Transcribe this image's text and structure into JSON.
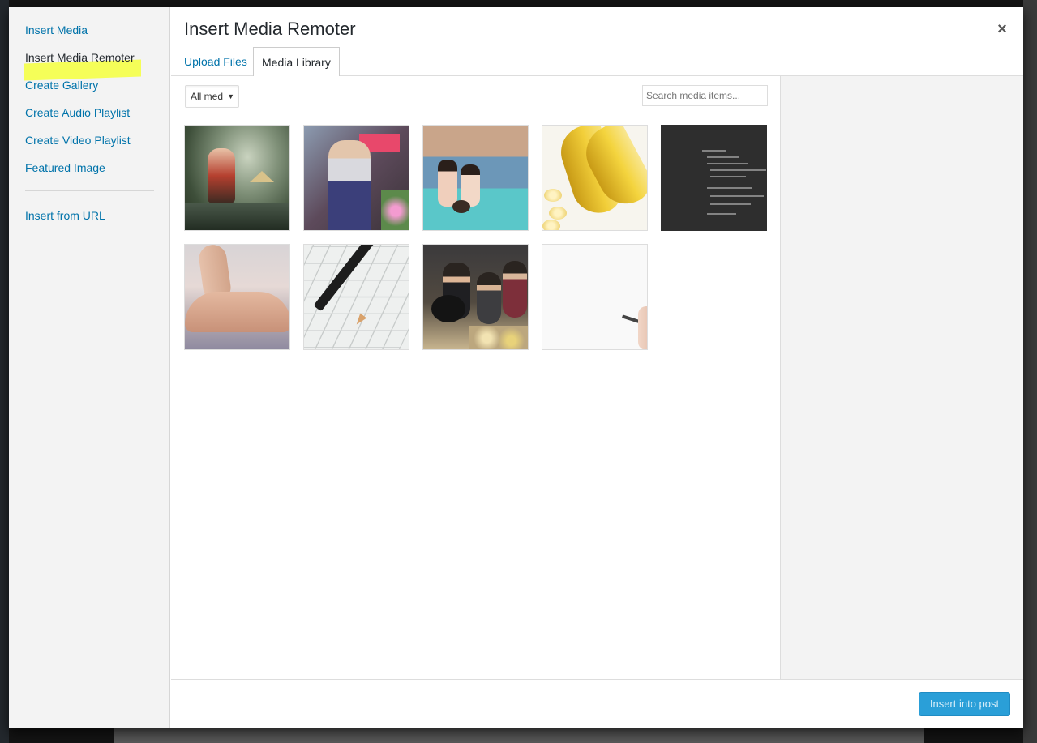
{
  "modal": {
    "title": "Insert Media Remoter",
    "close_glyph": "×"
  },
  "menu": {
    "items": [
      {
        "label": "Insert Media",
        "active": false
      },
      {
        "label": "Insert Media Remoter",
        "active": true
      },
      {
        "label": "Create Gallery",
        "active": false
      },
      {
        "label": "Create Audio Playlist",
        "active": false
      },
      {
        "label": "Create Video Playlist",
        "active": false
      },
      {
        "label": "Featured Image",
        "active": false
      },
      {
        "label": "Insert from URL",
        "active": false
      }
    ],
    "highlight_color": "#f5ff3c"
  },
  "tabs": [
    {
      "label": "Upload Files",
      "active": false
    },
    {
      "label": "Media Library",
      "active": true
    }
  ],
  "toolbar": {
    "filter_value": "All med",
    "filter_arrow": "▼",
    "search_placeholder": "Search media items..."
  },
  "media": [
    {
      "kind": "forest-woman"
    },
    {
      "kind": "crowd-man"
    },
    {
      "kind": "lake-girls"
    },
    {
      "kind": "bananas"
    },
    {
      "kind": "code-screen"
    },
    {
      "kind": "woman-bed"
    },
    {
      "kind": "pencil-plan"
    },
    {
      "kind": "guitar-group"
    },
    {
      "kind": "hand-writing"
    }
  ],
  "footer": {
    "insert_label": "Insert into post"
  },
  "colors": {
    "link": "#0073aa",
    "primary_button": "#2a9fd8"
  }
}
